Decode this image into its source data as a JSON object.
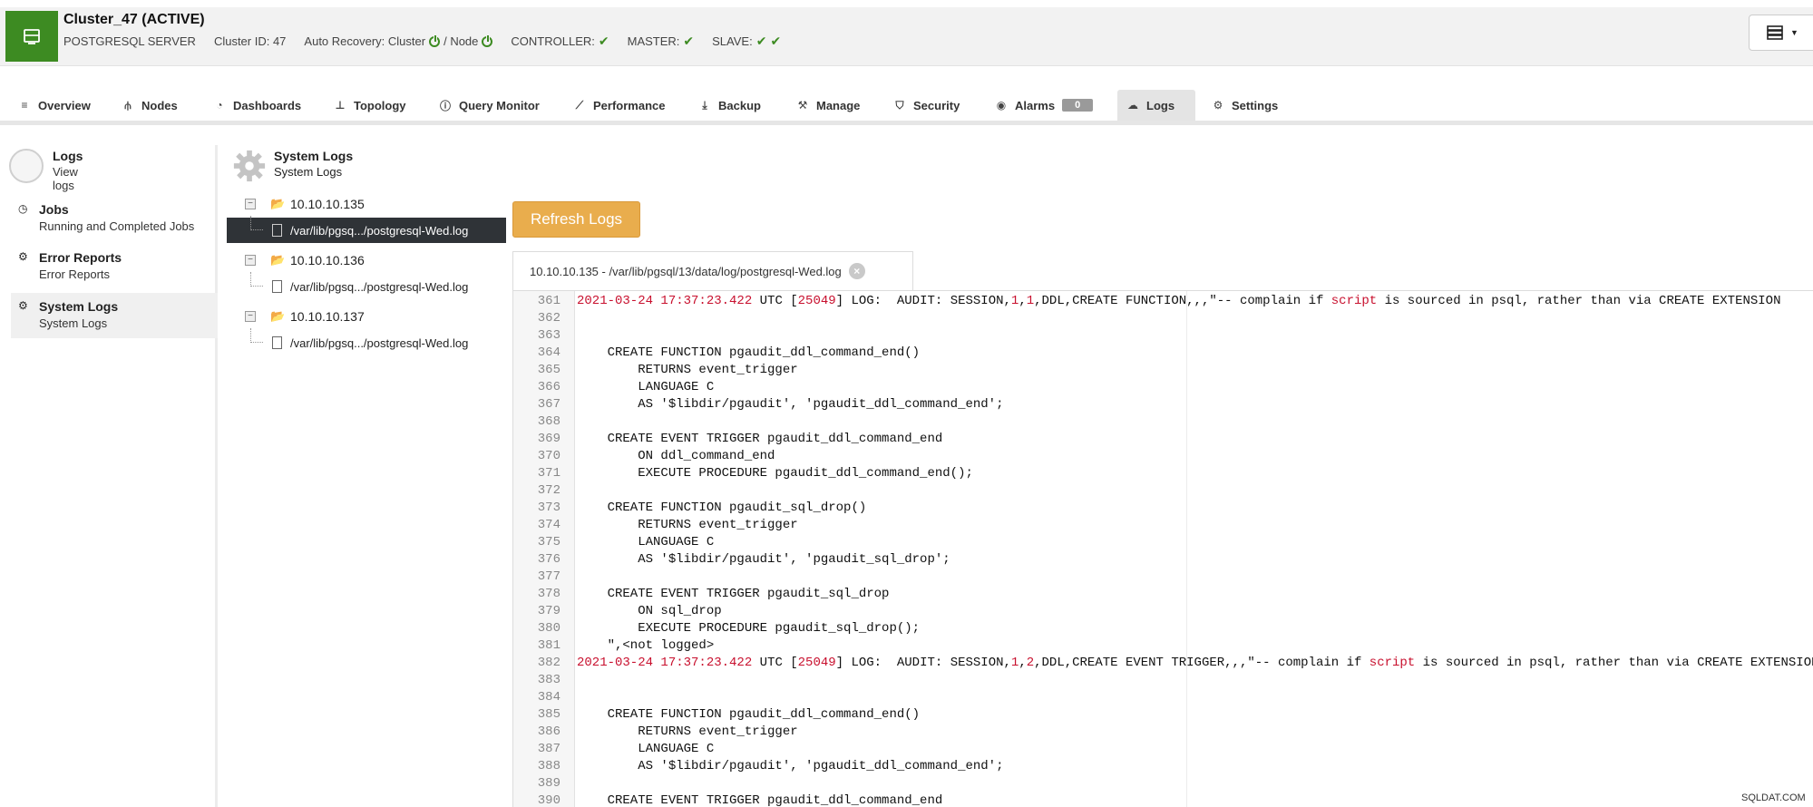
{
  "header": {
    "title": "Cluster_47 (ACTIVE)",
    "server_type": "POSTGRESQL SERVER",
    "cluster_id": "Cluster ID: 47",
    "auto_recovery_label": "Auto Recovery: Cluster",
    "node_label": "/ Node",
    "controller_label": "CONTROLLER:",
    "master_label": "MASTER:",
    "slave_label": "SLAVE:",
    "brand_color": "#3d8b22"
  },
  "tabs": [
    {
      "label": "Overview",
      "icon": "list-icon"
    },
    {
      "label": "Nodes",
      "icon": "nodes-icon"
    },
    {
      "label": "Dashboards",
      "icon": "dashboard-icon"
    },
    {
      "label": "Topology",
      "icon": "topology-icon"
    },
    {
      "label": "Query Monitor",
      "icon": "info-icon"
    },
    {
      "label": "Performance",
      "icon": "chart-icon"
    },
    {
      "label": "Backup",
      "icon": "download-icon"
    },
    {
      "label": "Manage",
      "icon": "wrench-icon"
    },
    {
      "label": "Security",
      "icon": "shield-icon"
    },
    {
      "label": "Alarms",
      "icon": "broadcast-icon",
      "badge": "0"
    },
    {
      "label": "Logs",
      "icon": "cloud-icon",
      "active": true
    },
    {
      "label": "Settings",
      "icon": "gear-icon"
    }
  ],
  "sidebar": {
    "header": {
      "title": "Logs",
      "subtitle": "View logs"
    },
    "items": [
      {
        "title": "Jobs",
        "subtitle": "Running and Completed Jobs",
        "icon": "clock-icon"
      },
      {
        "title": "Error Reports",
        "subtitle": "Error Reports",
        "icon": "gear-icon"
      },
      {
        "title": "System Logs",
        "subtitle": "System Logs",
        "icon": "gear-icon",
        "active": true
      }
    ]
  },
  "tree": {
    "title": "System Logs",
    "subtitle": "System Logs",
    "nodes": [
      {
        "host": "10.10.10.135",
        "file": "/var/lib/pgsq.../postgresql-Wed.log",
        "selected": true
      },
      {
        "host": "10.10.10.136",
        "file": "/var/lib/pgsq.../postgresql-Wed.log"
      },
      {
        "host": "10.10.10.137",
        "file": "/var/lib/pgsq.../postgresql-Wed.log"
      }
    ]
  },
  "refresh_label": "Refresh Logs",
  "file_tab": "10.10.10.135 - /var/lib/pgsql/13/data/log/postgresql-Wed.log",
  "log_lines": [
    {
      "n": "361",
      "parts": [
        [
          "r",
          "2021-03-24 17:37:23.422"
        ],
        [
          "n",
          " UTC ["
        ],
        [
          "r",
          "25049"
        ],
        [
          "n",
          "] LOG:  AUDIT: SESSION,"
        ],
        [
          "r",
          "1"
        ],
        [
          "n",
          ","
        ],
        [
          "r",
          "1"
        ],
        [
          "n",
          ",DDL,CREATE FUNCTION,,,\"-- complain if "
        ],
        [
          "r",
          "script"
        ],
        [
          "n",
          " is sourced in psql, rather than via CREATE EXTENSION"
        ]
      ]
    },
    {
      "n": "362",
      "parts": []
    },
    {
      "n": "363",
      "parts": []
    },
    {
      "n": "364",
      "parts": [
        [
          "n",
          "    CREATE FUNCTION pgaudit_ddl_command_end()"
        ]
      ]
    },
    {
      "n": "365",
      "parts": [
        [
          "n",
          "        RETURNS event_trigger"
        ]
      ]
    },
    {
      "n": "366",
      "parts": [
        [
          "n",
          "        LANGUAGE C"
        ]
      ]
    },
    {
      "n": "367",
      "parts": [
        [
          "n",
          "        AS '$libdir/pgaudit', 'pgaudit_ddl_command_end';"
        ]
      ]
    },
    {
      "n": "368",
      "parts": []
    },
    {
      "n": "369",
      "parts": [
        [
          "n",
          "    CREATE EVENT TRIGGER pgaudit_ddl_command_end"
        ]
      ]
    },
    {
      "n": "370",
      "parts": [
        [
          "n",
          "        ON ddl_command_end"
        ]
      ]
    },
    {
      "n": "371",
      "parts": [
        [
          "n",
          "        EXECUTE PROCEDURE pgaudit_ddl_command_end();"
        ]
      ]
    },
    {
      "n": "372",
      "parts": []
    },
    {
      "n": "373",
      "parts": [
        [
          "n",
          "    CREATE FUNCTION pgaudit_sql_drop()"
        ]
      ]
    },
    {
      "n": "374",
      "parts": [
        [
          "n",
          "        RETURNS event_trigger"
        ]
      ]
    },
    {
      "n": "375",
      "parts": [
        [
          "n",
          "        LANGUAGE C"
        ]
      ]
    },
    {
      "n": "376",
      "parts": [
        [
          "n",
          "        AS '$libdir/pgaudit', 'pgaudit_sql_drop';"
        ]
      ]
    },
    {
      "n": "377",
      "parts": []
    },
    {
      "n": "378",
      "parts": [
        [
          "n",
          "    CREATE EVENT TRIGGER pgaudit_sql_drop"
        ]
      ]
    },
    {
      "n": "379",
      "parts": [
        [
          "n",
          "        ON sql_drop"
        ]
      ]
    },
    {
      "n": "380",
      "parts": [
        [
          "n",
          "        EXECUTE PROCEDURE pgaudit_sql_drop();"
        ]
      ]
    },
    {
      "n": "381",
      "parts": [
        [
          "n",
          "    \",<not logged>"
        ]
      ]
    },
    {
      "n": "382",
      "parts": [
        [
          "r",
          "2021-03-24 17:37:23.422"
        ],
        [
          "n",
          " UTC ["
        ],
        [
          "r",
          "25049"
        ],
        [
          "n",
          "] LOG:  AUDIT: SESSION,"
        ],
        [
          "r",
          "1"
        ],
        [
          "n",
          ","
        ],
        [
          "r",
          "2"
        ],
        [
          "n",
          ",DDL,CREATE EVENT TRIGGER,,,\"-- complain if "
        ],
        [
          "r",
          "script"
        ],
        [
          "n",
          " is sourced in psql, rather than via CREATE EXTENSION"
        ]
      ]
    },
    {
      "n": "383",
      "parts": []
    },
    {
      "n": "384",
      "parts": []
    },
    {
      "n": "385",
      "parts": [
        [
          "n",
          "    CREATE FUNCTION pgaudit_ddl_command_end()"
        ]
      ]
    },
    {
      "n": "386",
      "parts": [
        [
          "n",
          "        RETURNS event_trigger"
        ]
      ]
    },
    {
      "n": "387",
      "parts": [
        [
          "n",
          "        LANGUAGE C"
        ]
      ]
    },
    {
      "n": "388",
      "parts": [
        [
          "n",
          "        AS '$libdir/pgaudit', 'pgaudit_ddl_command_end';"
        ]
      ]
    },
    {
      "n": "389",
      "parts": []
    },
    {
      "n": "390",
      "parts": [
        [
          "n",
          "    CREATE EVENT TRIGGER pgaudit_ddl_command_end"
        ]
      ]
    }
  ],
  "watermark": "SQLDAT.COM"
}
